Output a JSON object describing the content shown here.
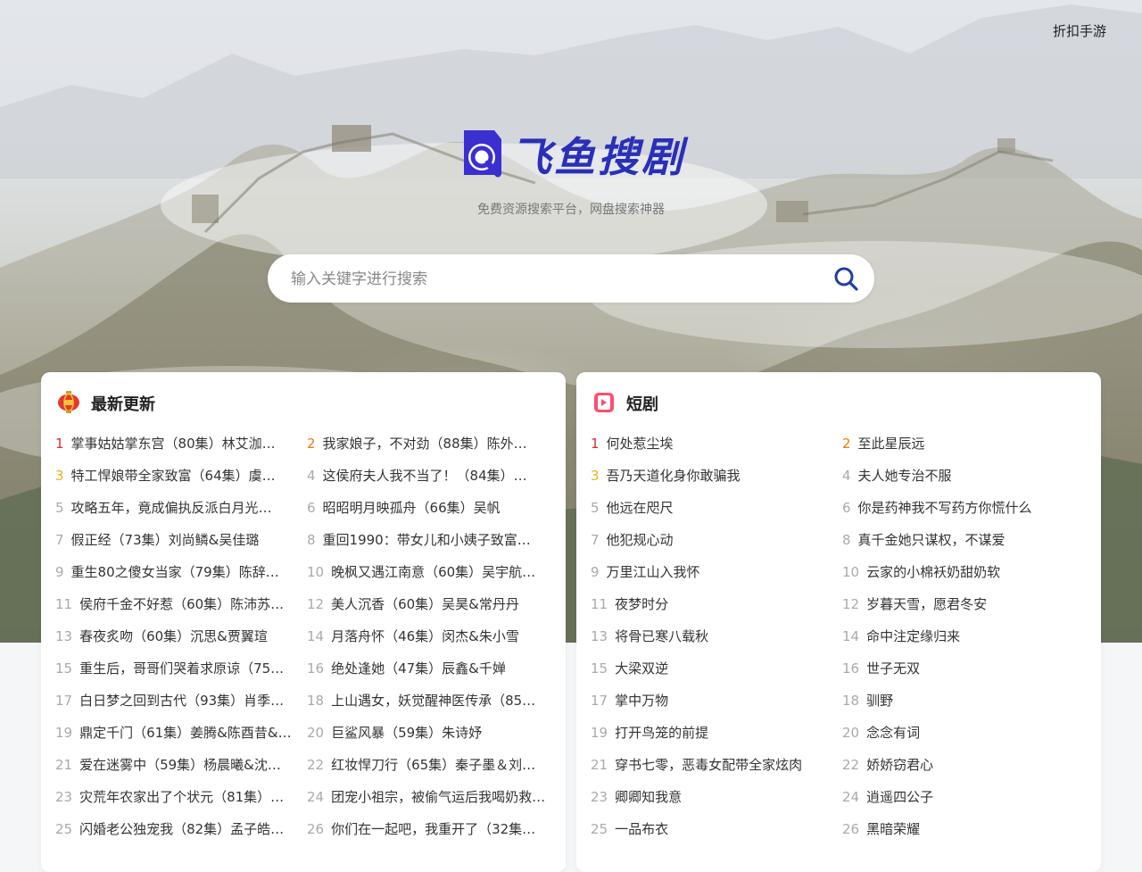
{
  "header": {
    "top_link": "折扣手游"
  },
  "logo": {
    "text": "飞鱼搜剧",
    "icon": "magnifier-logo-icon",
    "color": "#2a2fb8"
  },
  "subtitle": "免费资源搜索平台，网盘搜索神器",
  "search": {
    "placeholder": "输入关键字进行搜索",
    "value": "",
    "icon": "search-icon",
    "icon_color": "#1f3fa0"
  },
  "rank_colors": [
    "#e02b2b",
    "#f07a0b",
    "#e8b215"
  ],
  "latest": {
    "title": "最新更新",
    "icon": "lantern-icon",
    "items": [
      "掌事姑姑掌东宫（80集）林艾泇&…",
      "我家娘子，不对劲（88集）陈外＆…",
      "特工悍娘带全家致富（64集）虞彤彤",
      "这侯府夫人我不当了！（84集）侯…",
      "攻略五年，竟成偏执反派白月光（7…",
      "昭昭明月映孤舟（66集）吴帆",
      "假正经（73集）刘尚鳞&吴佳璐",
      "重回1990：带女儿和小姨子致富（…",
      "重生80之傻女当家（79集）陈辞（…",
      "晚枫又遇江南意（60集）吴宇航…",
      "侯府千金不好惹（60集）陈沛苏…",
      "美人沉香（60集）吴昊&常丹丹",
      "春夜炙吻（60集）沉思&贾翼瑄",
      "月落舟怀（46集）闵杰&朱小雪",
      "重生后，哥哥们哭着求原谅（75…",
      "绝处逢她（47集）辰鑫&千婵",
      "白日梦之回到古代（93集）肖季…",
      "上山遇女，妖觉醒神医传承（85…",
      "鼎定千门（61集）姜腾&陈酉昔&…",
      "巨鲨风暴（59集）朱诗妤",
      "爱在迷雾中（59集）杨晨曦&沈…",
      "红妆悍刀行（65集）秦子墨＆刘…",
      "灾荒年农家出了个状元（81集）…",
      "团宠小祖宗，被偷气运后我喝奶救…",
      "闪婚老公独宠我（82集）孟子皓…",
      "你们在一起吧，我重开了（32集…"
    ]
  },
  "short": {
    "title": "短剧",
    "icon": "video-play-icon",
    "items": [
      "何处惹尘埃",
      "至此星辰远",
      "吾乃天道化身你敢骗我",
      "夫人她专治不服",
      "他远在咫尺",
      "你是药神我不写药方你慌什么",
      "他犯规心动",
      "真千金她只谋权，不谋爱",
      "万里江山入我怀",
      "云家的小棉袄奶甜奶软",
      "夜梦时分",
      "岁暮天雪，愿君冬安",
      "将骨已寒八载秋",
      "命中注定缘归来",
      "大梁双逆",
      "世子无双",
      "掌中万物",
      "驯野",
      "打开鸟笼的前提",
      "念念有词",
      "穿书七零，恶毒女配带全家炫肉",
      "娇娇窃君心",
      "卿卿知我意",
      "逍遥四公子",
      "一品布衣",
      "黑暗荣耀"
    ]
  }
}
